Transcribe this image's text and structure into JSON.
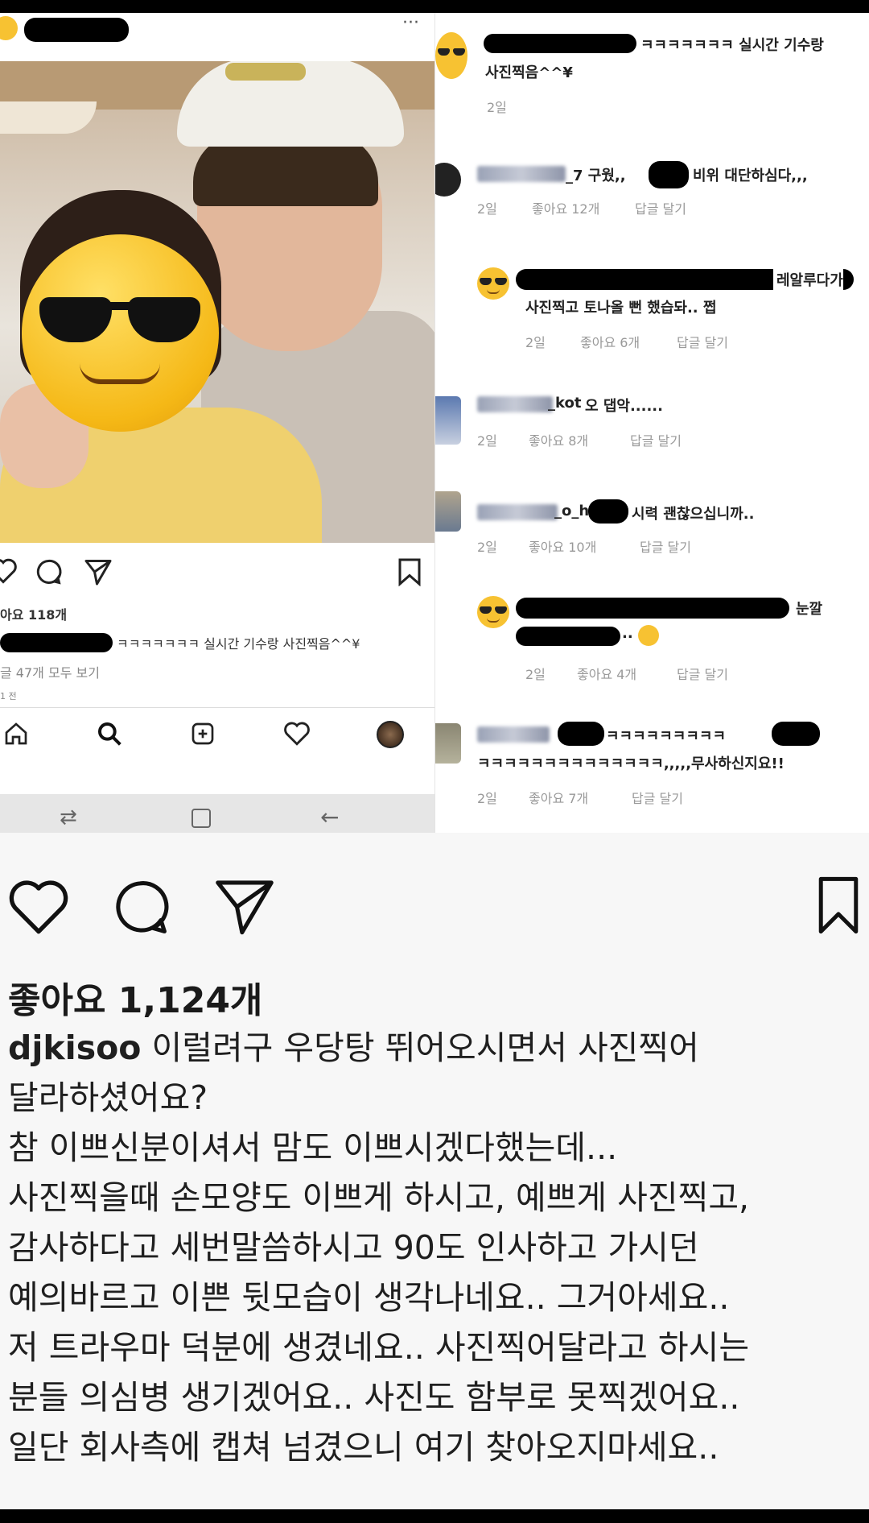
{
  "left_post": {
    "likes": "아요 118개",
    "caption_tail": "ㅋㅋㅋㅋㅋㅋㅋ 실시간 기수랑 사진찍음^^¥",
    "view_comments": "글 47개 모두 보기",
    "time": "1 전",
    "icons": {
      "like": "heart-icon",
      "comment": "comment-icon",
      "share": "send-icon",
      "save": "bookmark-icon"
    },
    "nav": [
      "home-icon",
      "search-icon",
      "add-icon",
      "heart-icon",
      "profile-icon"
    ]
  },
  "right_comments": {
    "top": {
      "text": "ㅋㅋㅋㅋㅋㅋㅋ 실시간 기수랑",
      "text2": "사진찍음^^¥",
      "time": "2일"
    },
    "items": [
      {
        "name": "ll_r.....",
        "text": "_7 구웠,,",
        "text_after": "비위 대단하심다,,,",
        "time": "2일",
        "likes": "좋아요 12개",
        "reply": "답글 달기"
      },
      {
        "name": "",
        "text": "레알루다가",
        "text2": "사진찍고 토나올 뻔 했습돠.. 쩝",
        "time": "2일",
        "likes": "좋아요 6개",
        "reply": "답글 달기"
      },
      {
        "name": "_kot",
        "text": "오 댑악......",
        "time": "2일",
        "likes": "좋아요 8개",
        "reply": "답글 달기"
      },
      {
        "name": "_o_h",
        "text": "시력 괜찮으십니까..",
        "time": "2일",
        "likes": "좋아요 10개",
        "reply": "답글 달기"
      },
      {
        "name": "",
        "text": "눈깔",
        "text2": "..",
        "time": "2일",
        "likes": "좋아요 4개",
        "reply": "답글 달기"
      },
      {
        "name": "",
        "text": "ㅋㅋㅋㅋㅋㅋㅋㅋㅋ",
        "text2": "ㅋㅋㅋㅋㅋㅋㅋㅋㅋㅋㅋㅋㅋㅋ,,,,,무사하신지요!!",
        "time": "2일",
        "likes": "좋아요 7개",
        "reply": "답글 달기"
      }
    ]
  },
  "main_post": {
    "likes": "좋아요 1,124개",
    "username": "djkisoo",
    "caption_lines": [
      " 이럴려구 우당탕 뛰어오시면서 사진찍어",
      "달라하셨어요?",
      "참 이쁘신분이셔서 맘도 이쁘시겠다했는데...",
      "사진찍을때 손모양도 이쁘게 하시고, 예쁘게 사진찍고,",
      "감사하다고 세번말씀하시고 90도 인사하고 가시던",
      "예의바르고 이쁜 뒷모습이 생각나네요.. 그거아세요..",
      "저 트라우마 덕분에 생겼네요.. 사진찍어달라고 하시는",
      "분들 의심병 생기겠어요.. 사진도 함부로 못찍겠어요..",
      "일단 회사측에 캡쳐 넘겼으니 여기 찾아오지마세요.."
    ],
    "icons": {
      "like": "heart-icon",
      "comment": "comment-icon",
      "share": "send-icon",
      "save": "bookmark-icon"
    }
  }
}
